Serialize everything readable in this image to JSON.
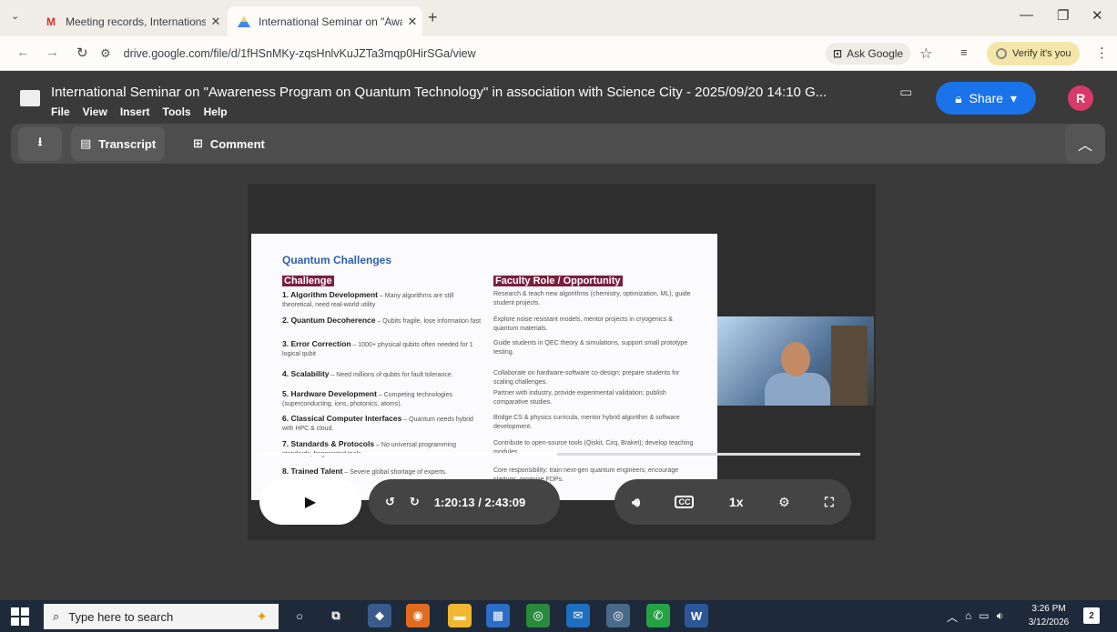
{
  "browser": {
    "tabs": [
      {
        "title": "Meeting records, Internations",
        "favicon": "gmail-icon"
      },
      {
        "title": "International Seminar on \"Awa",
        "favicon": "google-drive-icon"
      }
    ],
    "url": "drive.google.com/file/d/1fHSnMKy-zqsHnlvKuJZTa3mqp0HirSGa/view",
    "ask_google": "Ask Google",
    "verify": "Verify it's you"
  },
  "viewer": {
    "title": "International Seminar on \"Awareness Program on Quantum Technology\" in association with Science City - 2025/09/20 14:10 G...",
    "menu": [
      "File",
      "View",
      "Insert",
      "Tools",
      "Help"
    ],
    "share": "Share",
    "avatar": "R",
    "toolbar": {
      "transcript": "Transcript",
      "comment": "Comment"
    }
  },
  "slide": {
    "title": "Quantum Challenges",
    "col1": "Challenge",
    "col2": "Faculty Role / Opportunity",
    "rows": [
      {
        "name": "1. Algorithm Development",
        "desc": "– Many algorithms are still theoretical, need real-world utility",
        "role": "Research & teach new algorithms (chemistry, optimization, ML), guide student projects."
      },
      {
        "name": "2. Quantum Decoherence",
        "desc": "– Qubits fragile, lose information fast",
        "role": "Explore noise resistant models, mentor projects in cryogenics & quantum materials."
      },
      {
        "name": "3. Error Correction",
        "desc": "– 1000+ physical qubits often needed for 1 logical qubit",
        "role": "Guide students in QEC theory & simulations, support small prototype testing."
      },
      {
        "name": "4. Scalability",
        "desc": "– Need millions of qubits for fault tolerance.",
        "role": "Collaborate on hardware-software co-design; prepare students for scaling challenges."
      },
      {
        "name": "5. Hardware Development",
        "desc": "– Competing technologies (superconducting, ions, photonics, atoms).",
        "role": "Partner with industry, provide experimental validation; publish comparative studies."
      },
      {
        "name": "6. Classical Computer Interfaces",
        "desc": "– Quantum needs hybrid with HPC & cloud.",
        "role": "Bridge CS & physics curricula, mentor hybrid algorithm & software development."
      },
      {
        "name": "7. Standards & Protocols",
        "desc": "– No universal programming standards, fragmented tools.",
        "role": "Contribute to open-source tools (Qiskit, Cirq, Braket); develop teaching modules."
      },
      {
        "name": "8. Trained Talent",
        "desc": "– Severe global shortage of experts.",
        "role": "Core responsibility: train next-gen quantum engineers, encourage startups, organize FDPs."
      }
    ]
  },
  "player": {
    "time": "1:20:13 / 2:43:09",
    "speed": "1x",
    "progress": 0.49
  },
  "taskbar": {
    "search_placeholder": "Type here to search",
    "time": "3:26 PM",
    "date": "3/12/2026",
    "notif": "2"
  }
}
